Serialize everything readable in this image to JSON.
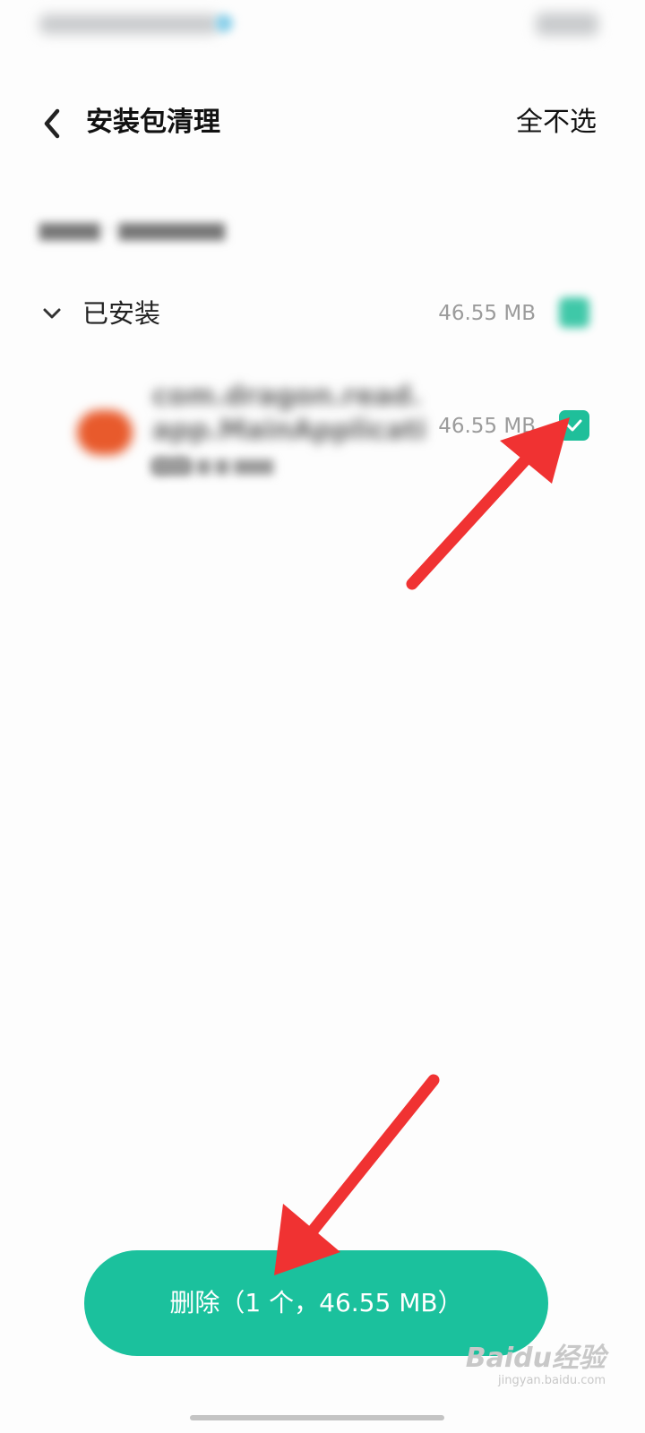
{
  "header": {
    "title": "安装包清理",
    "deselect_all_label": "全不选"
  },
  "group": {
    "label": "已安装",
    "size": "46.55 MB",
    "checked": true
  },
  "app_item": {
    "name": "com.dragon.read.app.MainApplication",
    "size": "46.55 MB",
    "checked": true
  },
  "delete_button": {
    "label": "删除（1 个，46.55 MB）"
  },
  "watermark": {
    "logo": "Baidu经验",
    "url": "jingyan.baidu.com"
  },
  "colors": {
    "accent": "#1bc19d",
    "annotation_arrow": "#f03232"
  }
}
